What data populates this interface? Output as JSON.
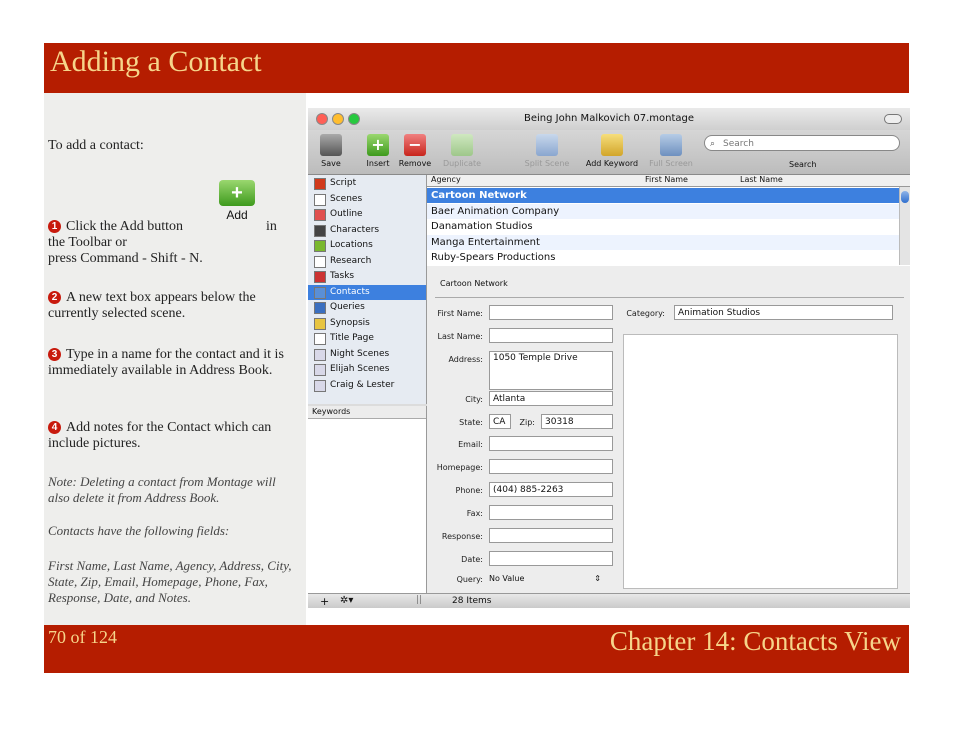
{
  "slide": {
    "title": "Adding a Contact",
    "page": "70 of 124",
    "chapter": "Chapter 14: Contacts View"
  },
  "left": {
    "intro": "To add a contact:",
    "step1_num": "1",
    "step1_a": "Click the Add button",
    "step1_b": "in the Toolbar or",
    "step1_c": "press Command - Shift - N.",
    "add_icon_label": "Add",
    "step2_num": "2",
    "step2": "A new text box appears below the currently selected scene.",
    "step3_num": "3",
    "step3": "Type in a name for the contact and it is immediately available in Address Book.",
    "step4_num": "4",
    "step4": "Add notes for the Contact which can include pictures.",
    "note1": "Note: Deleting a contact from Montage will also delete it from Address Book.",
    "note2": "Contacts have the following fields:",
    "note3": "First Name, Last Name, Agency, Address, City, State, Zip, Email, Homepage, Phone, Fax, Response, Date, and Notes."
  },
  "app": {
    "window_title": "Being John Malkovich 07.montage",
    "toolbar": {
      "save": "Save",
      "insert": "Insert",
      "remove": "Remove",
      "duplicate": "Duplicate",
      "split_scene": "Split Scene",
      "add_keyword": "Add Keyword",
      "full_screen": "Full Screen",
      "search_placeholder": "Search",
      "search_label": "Search"
    },
    "sidebar": [
      {
        "label": "Script",
        "color": "#d13a1c"
      },
      {
        "label": "Scenes",
        "color": "#ffffff"
      },
      {
        "label": "Outline",
        "color": "#e05050"
      },
      {
        "label": "Characters",
        "color": "#444444"
      },
      {
        "label": "Locations",
        "color": "#7ab82f"
      },
      {
        "label": "Research",
        "color": "#ffffff"
      },
      {
        "label": "Tasks",
        "color": "#cc3333"
      },
      {
        "label": "Contacts",
        "color": "#5a8fd6"
      },
      {
        "label": "Queries",
        "color": "#3b6fbf"
      },
      {
        "label": "Synopsis",
        "color": "#e8c542"
      },
      {
        "label": "Title Page",
        "color": "#ffffff"
      },
      {
        "label": "Night Scenes",
        "color": "#d8d8e8"
      },
      {
        "label": "Elijah Scenes",
        "color": "#d8d8e8"
      },
      {
        "label": "Craig & Lester",
        "color": "#d8d8e8"
      }
    ],
    "keywords_header": "Keywords",
    "columns": {
      "agency": "Agency",
      "first": "First Name",
      "last": "Last Name"
    },
    "rows": [
      "Cartoon Network",
      "Baer Animation Company",
      "Danamation Studios",
      "Manga Entertainment",
      "Ruby-Spears Productions"
    ],
    "detail": {
      "heading": "Cartoon Network",
      "first_name_label": "First Name:",
      "first_name": "",
      "category_label": "Category:",
      "category": "Animation Studios",
      "last_name_label": "Last Name:",
      "last_name": "",
      "address_label": "Address:",
      "address": "1050 Temple Drive",
      "city_label": "City:",
      "city": "Atlanta",
      "state_label": "State:",
      "state": "CA",
      "zip_label": "Zip:",
      "zip": "30318",
      "email_label": "Email:",
      "email": "",
      "homepage_label": "Homepage:",
      "homepage": "",
      "phone_label": "Phone:",
      "phone": "(404) 885-2263",
      "fax_label": "Fax:",
      "fax": "",
      "response_label": "Response:",
      "response": "",
      "date_label": "Date:",
      "date": "",
      "query_label": "Query:",
      "query": "No Value"
    },
    "items_count": "28 Items"
  }
}
